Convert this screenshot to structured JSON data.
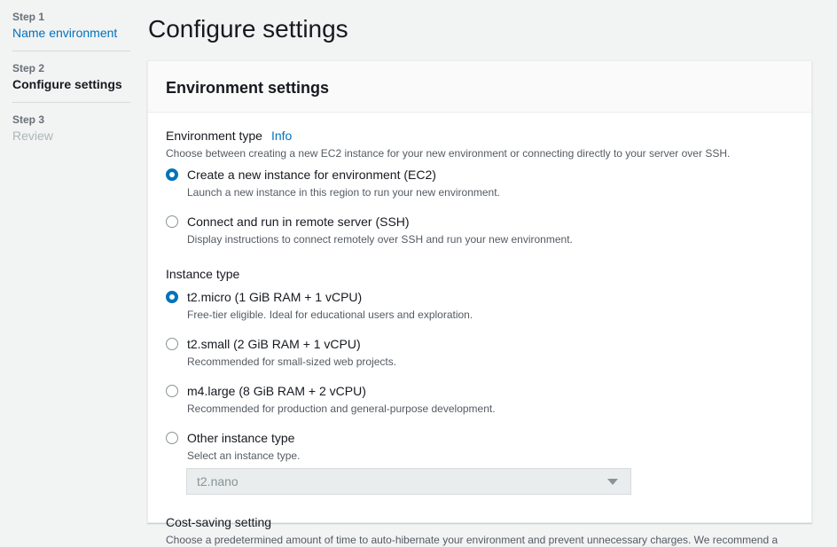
{
  "steps": [
    {
      "num": "Step 1",
      "label": "Name environment",
      "state": "link"
    },
    {
      "num": "Step 2",
      "label": "Configure settings",
      "state": "current"
    },
    {
      "num": "Step 3",
      "label": "Review",
      "state": "disabled"
    }
  ],
  "page": {
    "title": "Configure settings"
  },
  "panel": {
    "title": "Environment settings",
    "environment_type": {
      "label": "Environment type",
      "info": "Info",
      "description": "Choose between creating a new EC2 instance for your new environment or connecting directly to your server over SSH.",
      "options": [
        {
          "title": "Create a new instance for environment (EC2)",
          "desc": "Launch a new instance in this region to run your new environment.",
          "selected": true
        },
        {
          "title": "Connect and run in remote server (SSH)",
          "desc": "Display instructions to connect remotely over SSH and run your new environment.",
          "selected": false
        }
      ]
    },
    "instance_type": {
      "label": "Instance type",
      "options": [
        {
          "title": "t2.micro (1 GiB RAM + 1 vCPU)",
          "desc": "Free-tier eligible. Ideal for educational users and exploration.",
          "selected": true
        },
        {
          "title": "t2.small (2 GiB RAM + 1 vCPU)",
          "desc": "Recommended for small-sized web projects.",
          "selected": false
        },
        {
          "title": "m4.large (8 GiB RAM + 2 vCPU)",
          "desc": "Recommended for production and general-purpose development.",
          "selected": false
        },
        {
          "title": "Other instance type",
          "desc": "Select an instance type.",
          "selected": false
        }
      ],
      "other_select_value": "t2.nano"
    },
    "cost_saving": {
      "label": "Cost-saving setting",
      "description": "Choose a predetermined amount of time to auto-hibernate your environment and prevent unnecessary charges. We recommend a"
    }
  },
  "colors": {
    "accent": "#0073bb",
    "background": "#f2f3f3"
  }
}
